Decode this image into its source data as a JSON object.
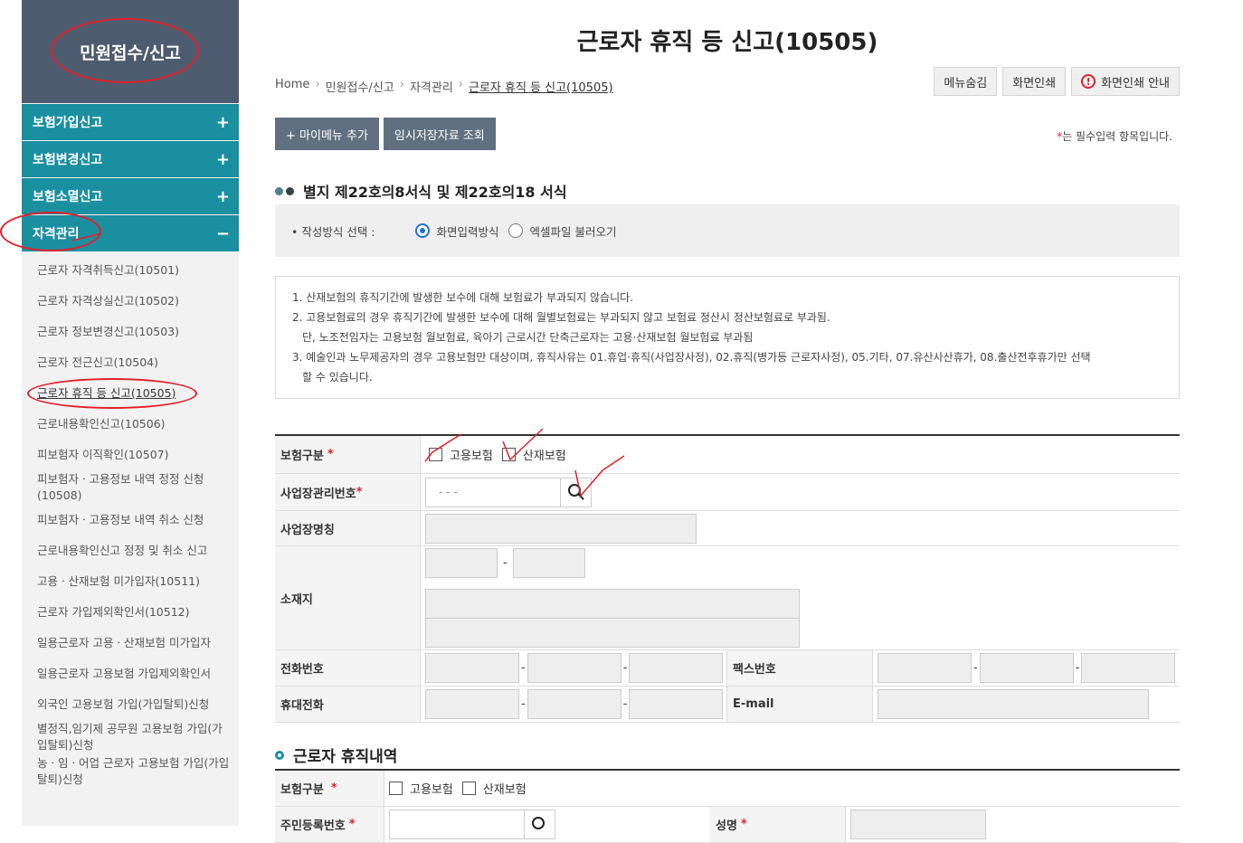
{
  "sidebar": {
    "title": "민원접수/신고",
    "groups": [
      {
        "label": "보험가입신고",
        "sign": "+"
      },
      {
        "label": "보험변경신고",
        "sign": "+"
      },
      {
        "label": "보험소멸신고",
        "sign": "+"
      },
      {
        "label": "자격관리",
        "sign": "−"
      }
    ],
    "items": [
      "근로자 자격취득신고(10501)",
      "근로자 자격상실신고(10502)",
      "근로자 정보변경신고(10503)",
      "근로자 전근신고(10504)",
      "근로자 휴직 등 신고(10505)",
      "근로내용확인신고(10506)",
      "피보험자 이직확인(10507)",
      "피보험자ㆍ고용정보 내역 정정 신청(10508)",
      "피보험자ㆍ고용정보 내역 취소 신청",
      "근로내용확인신고 정정 및 취소 신고",
      "고용ㆍ산재보험 미가입자(10511)",
      "근로자 가입제외확인서(10512)",
      "일용근로자 고용ㆍ산재보험 미가입자",
      "일용근로자 고용보험 가입제외확인서",
      "외국인 고용보험 가입(가입탈퇴)신청",
      "별정직,임기제 공무원 고용보험 가입(가입탈퇴)신청",
      "농ㆍ임ㆍ어업 근로자 고용보험 가입(가입탈퇴)신청"
    ]
  },
  "page": {
    "title": "근로자 휴직 등 신고(10505)",
    "breadcrumb": [
      "Home",
      "민원접수/신고",
      "자격관리",
      "근로자 휴직 등 신고(10505)"
    ],
    "top_buttons": [
      "메뉴숨김",
      "화면인쇄",
      "화면인쇄 안내"
    ],
    "add_menu": "+ 마이메뉴 추가",
    "temp_save": "임시저장자료 조회",
    "req_note_star": "*",
    "req_note": "는 필수입력 항목입니다.",
    "section1": "별지 제22호의8서식 및 제22호의18 서식",
    "method_label": "• 작성방식 선택 :",
    "method_options": [
      "화면입력방식",
      "엑셀파일 불러오기"
    ],
    "notices": [
      "1. 산재보험의 휴직기간에 발생한 보수에 대해 보험료가 부과되지 않습니다.",
      "2. 고용보험료의 경우 휴직기간에 발생한 보수에 대해 월별보험료는 부과되지 않고 보험료 정산시 정산보험료로 부과됨.",
      "단, 노조전임자는 고용보험 월보험료, 육아기 근로시간 단축근로자는 고용·산재보험 월보험료 부과됨",
      "3. 예술인과 노무제공자의 경우 고용보험만 대상이며, 휴직사유는 01.휴업·휴직(사업장사정), 02.휴직(병가등 근로자사정), 05.기타, 07.유산사산휴가, 08.출산전후휴가만 선택",
      "할 수 있습니다."
    ],
    "form": {
      "insurance_label": "보험구분",
      "insurance_opts": [
        "고용보험",
        "산재보험"
      ],
      "biz_no_label": "사업장관리번호",
      "biz_no_value": "-   -    -",
      "biz_name_label": "사업장명칭",
      "address_label": "소재지",
      "phone_label": "전화번호",
      "fax_label": "팩스번호",
      "mobile_label": "휴대전화",
      "email_label": "E-mail"
    },
    "section2": "근로자 휴직내역",
    "form2": {
      "insurance_label": "보험구분",
      "insurance_opts": [
        "고용보험",
        "산재보험"
      ],
      "rrn_label": "주민등록번호",
      "name_label": "성명"
    }
  }
}
